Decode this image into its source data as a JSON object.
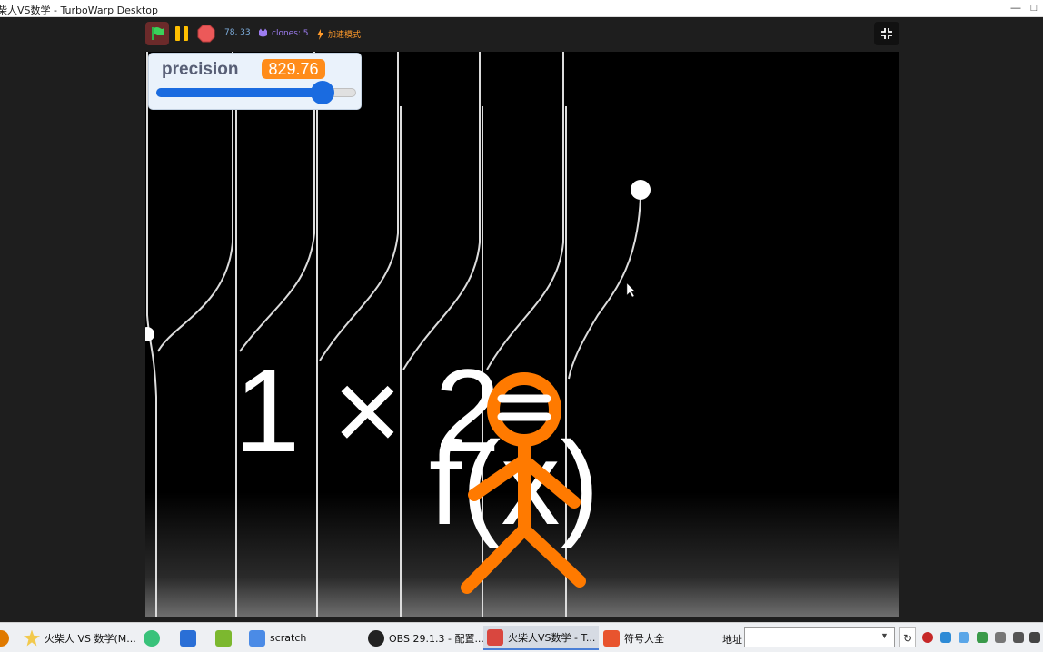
{
  "window": {
    "title": "火柴人VS数学 - TurboWarp Desktop"
  },
  "controls": {
    "mouse_xy": "78, 33",
    "clones": "clones: 5",
    "turbo": "加速模式"
  },
  "monitor": {
    "label": "precision",
    "value": "829.76",
    "slider_fraction": 0.83
  },
  "stage": {
    "equation_left": "1 × 2",
    "equation_right": "f(x)",
    "accent_color": "#ff7a00"
  },
  "taskbar": {
    "items": [
      {
        "label": "火柴人 VS 数学(M...",
        "icon": "star-folder-icon"
      },
      {
        "label": "",
        "icon": "music-app-icon"
      },
      {
        "label": "",
        "icon": "wps-writer-icon"
      },
      {
        "label": "",
        "icon": "cubie-app-icon"
      },
      {
        "label": "scratch",
        "icon": "folder-icon"
      },
      {
        "label": "OBS 29.1.3 - 配置...",
        "icon": "obs-icon"
      },
      {
        "label": "火柴人VS数学 - T...",
        "icon": "turbowarp-icon"
      },
      {
        "label": "符号大全",
        "icon": "sogou-icon"
      }
    ],
    "address_label": "地址",
    "address_value": ""
  }
}
